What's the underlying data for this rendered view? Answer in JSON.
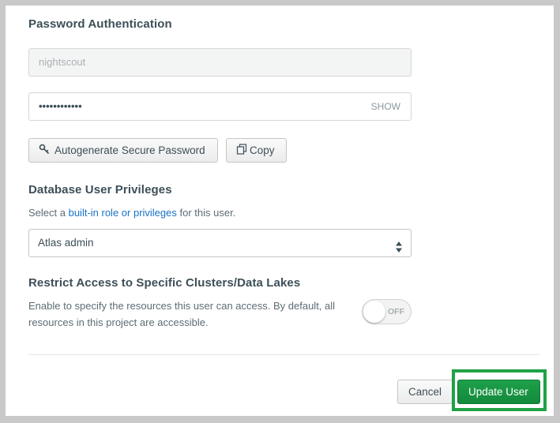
{
  "password_section": {
    "title": "Password Authentication",
    "username_value": "nightscout",
    "password_value": "••••••••••••",
    "show_label": "SHOW",
    "autogenerate_label": "Autogenerate Secure Password",
    "copy_label": "Copy"
  },
  "privileges_section": {
    "title": "Database User Privileges",
    "help_prefix": "Select a ",
    "help_link": "built-in role or privileges",
    "help_suffix": " for this user.",
    "role_selected": "Atlas admin"
  },
  "restrict_section": {
    "title": "Restrict Access to Specific Clusters/Data Lakes",
    "description_line1": "Enable to specify the resources this user can access. By default, all",
    "description_line2": "resources in this project are accessible.",
    "toggle_label": "OFF"
  },
  "footer": {
    "cancel_label": "Cancel",
    "update_label": "Update User"
  },
  "colors": {
    "primary": "#139540",
    "highlight": "#1fa245",
    "link": "#1a73c8"
  }
}
